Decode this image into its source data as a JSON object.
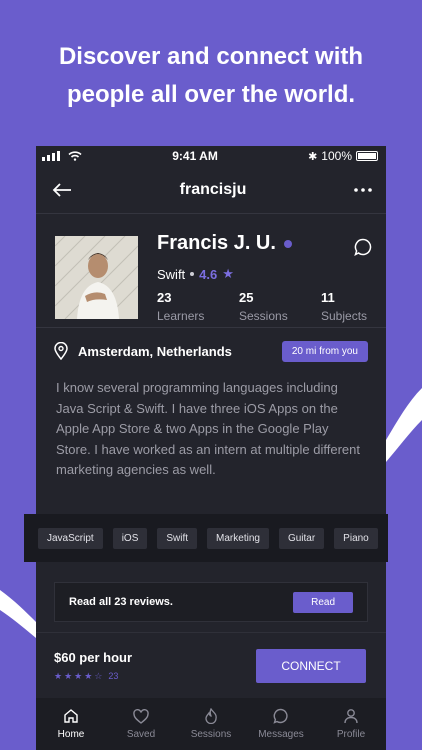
{
  "headline": {
    "line1": "Discover and connect with",
    "line2": "people all over the world."
  },
  "status": {
    "time": "9:41 AM",
    "battery": "100%"
  },
  "nav": {
    "title": "francisju"
  },
  "profile": {
    "name": "Francis J. U.",
    "skill": "Swift",
    "rating": "4.6",
    "stats": [
      {
        "value": "23",
        "label": "Learners"
      },
      {
        "value": "25",
        "label": "Sessions"
      },
      {
        "value": "11",
        "label": "Subjects"
      }
    ]
  },
  "location": {
    "city": "Amsterdam, Netherlands",
    "distance": "20 mi from you"
  },
  "bio": "I know several programming languages including Java Script & Swift. I have three iOS Apps on the Apple App Store & two Apps in the Google Play Store. I have worked as an intern at multiple different marketing agencies as well.",
  "tags": [
    "JavaScript",
    "iOS",
    "Swift",
    "Marketing",
    "Guitar",
    "Piano"
  ],
  "reviews": {
    "text": "Read all 23 reviews.",
    "button": "Read"
  },
  "pricing": {
    "price": "$60 per hour",
    "review_count": "23",
    "stars": 4,
    "connect": "CONNECT"
  },
  "tabs": [
    {
      "label": "Home",
      "icon": "home-icon"
    },
    {
      "label": "Saved",
      "icon": "heart-icon"
    },
    {
      "label": "Sessions",
      "icon": "flame-icon"
    },
    {
      "label": "Messages",
      "icon": "message-icon"
    },
    {
      "label": "Profile",
      "icon": "person-icon"
    }
  ],
  "colors": {
    "accent": "#6a5dcc",
    "background": "#23242c",
    "tagbar": "#191a20"
  }
}
